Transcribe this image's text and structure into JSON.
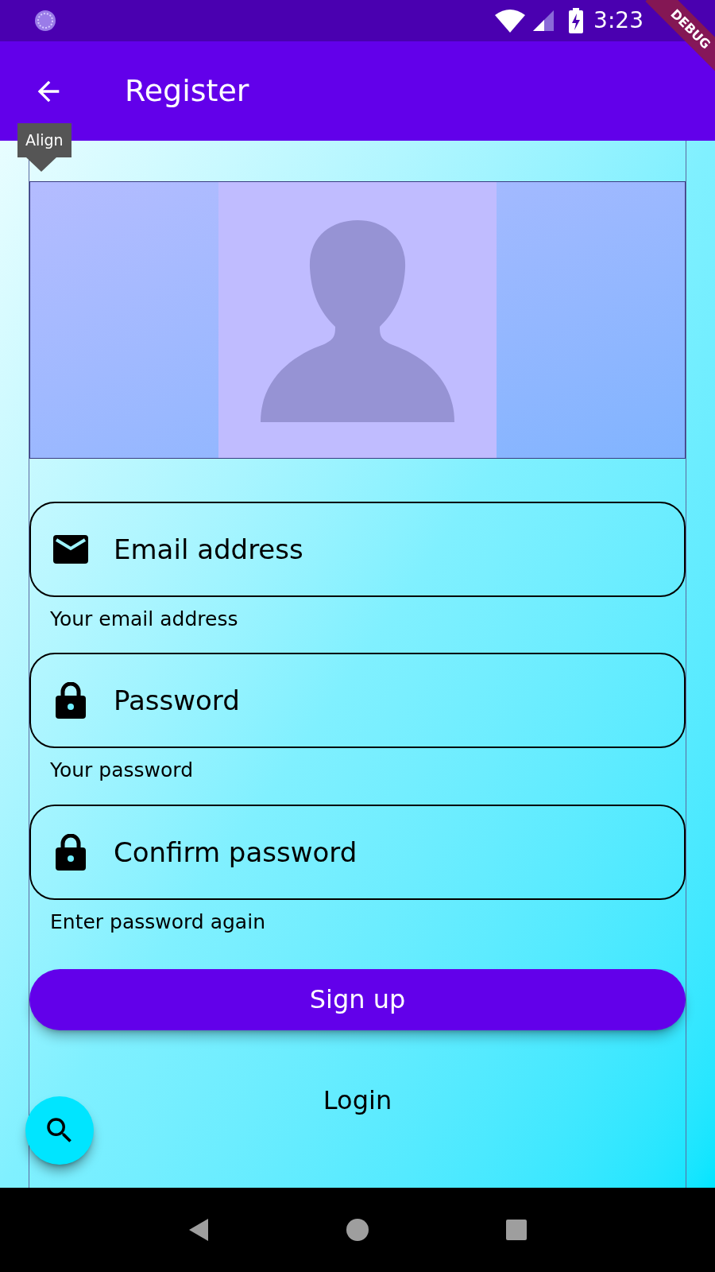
{
  "status_bar": {
    "time": "3:23"
  },
  "app_bar": {
    "title": "Register"
  },
  "debug_banner": "DEBUG",
  "tooltip": "Align",
  "fields": [
    {
      "kind": "email",
      "placeholder": "Email address",
      "helper": "Your email address"
    },
    {
      "kind": "password",
      "placeholder": "Password",
      "helper": "Your password"
    },
    {
      "kind": "password",
      "placeholder": "Confirm password",
      "helper": "Enter password again"
    }
  ],
  "sign_up_button": "Sign up",
  "login_link": "Login"
}
